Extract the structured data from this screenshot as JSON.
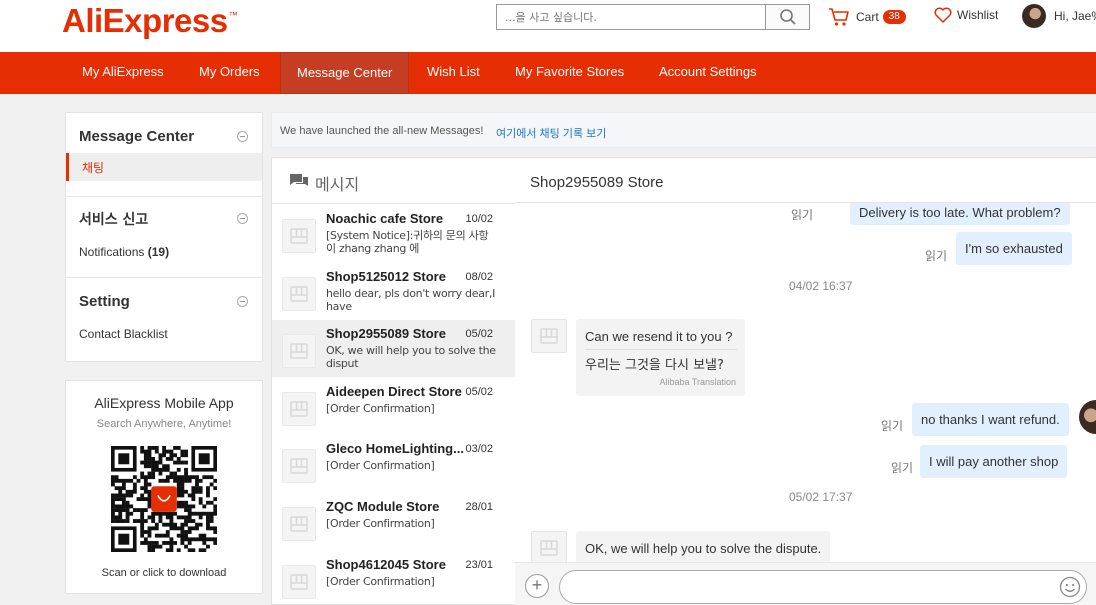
{
  "header": {
    "logo": "AliExpress",
    "search": {
      "placeholder": "...을 사고 싶습니다."
    },
    "cart_label": "Cart",
    "cart_count": "38",
    "wishlist_label": "Wishlist",
    "greeting": "Hi, Jae%"
  },
  "nav": {
    "items": [
      "My AliExpress",
      "My Orders",
      "Message Center",
      "Wish List",
      "My Favorite Stores",
      "Account Settings"
    ],
    "active": "Message Center"
  },
  "sidebar": {
    "message_center_title": "Message Center",
    "chat_label": "채팅",
    "service_title": "서비스 신고",
    "notifications_label": "Notifications",
    "notifications_count": "(19)",
    "setting_title": "Setting",
    "blacklist_label": "Contact Blacklist"
  },
  "app_promo": {
    "title": "AliExpress Mobile App",
    "subtitle": "Search Anywhere, Anytime!",
    "download": "Scan or click to download"
  },
  "banner": {
    "text": "We have launched the all-new Messages!",
    "link": "여기에서 채팅 기록 보기"
  },
  "conversations": {
    "title": "메시지",
    "items": [
      {
        "name": "Noachic cafe Store",
        "date": "10/02",
        "preview": "[System Notice]:귀하의 문의 사항이 zhang zhang 에"
      },
      {
        "name": "Shop5125012 Store",
        "date": "08/02",
        "preview": "hello dear, pls don't worry dear,I have"
      },
      {
        "name": "Shop2955089 Store",
        "date": "05/02",
        "preview": "OK, we will help you to solve the disput"
      },
      {
        "name": "Aideepen Direct Store",
        "date": "05/02",
        "preview": "[Order Confirmation]"
      },
      {
        "name": "Gleco HomeLighting...",
        "date": "03/02",
        "preview": "[Order Confirmation]"
      },
      {
        "name": "ZQC Module Store",
        "date": "28/01",
        "preview": "[Order Confirmation]"
      },
      {
        "name": "Shop4612045 Store",
        "date": "23/01",
        "preview": "[Order Confirmation]"
      }
    ],
    "selected_index": 2
  },
  "chat": {
    "title": "Shop2955089 Store",
    "read_label": "읽기",
    "messages": {
      "m1": "Delivery is too late. What problem?",
      "m2": "I'm so exhausted",
      "ts1": "04/02 16:37",
      "m3": "Can we resend it to you ?",
      "m3_translated": "우리는 그것을 다시 보낼?",
      "translation_note": "Alibaba Translation",
      "m4": "no thanks I want refund.",
      "m5": "I will pay another shop",
      "ts2": "05/02 17:37",
      "m6": "OK, we will help you to solve the dispute."
    }
  },
  "colors": {
    "brand": "#e62e04",
    "nav_active": "#c53e24",
    "link": "#1b79c7",
    "own_bubble": "#e2efff"
  }
}
